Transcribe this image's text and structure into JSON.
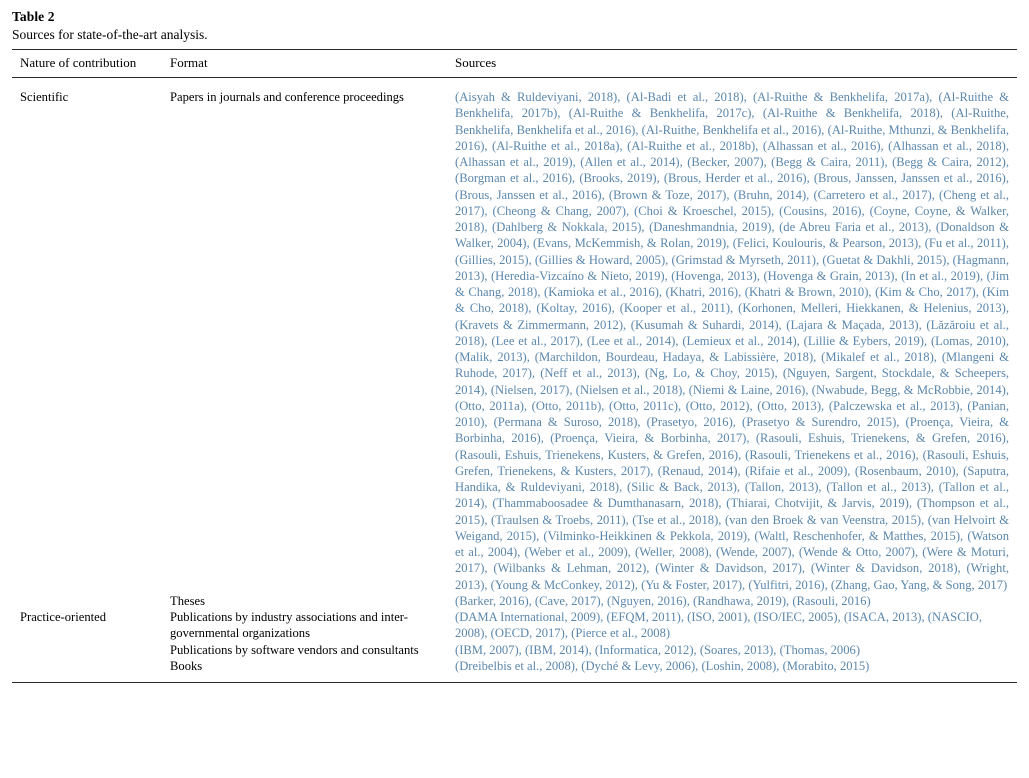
{
  "caption": {
    "label": "Table 2",
    "text": "Sources for state-of-the-art analysis."
  },
  "table": {
    "headers": {
      "nature": "Nature of contribution",
      "format": "Format",
      "sources": "Sources"
    },
    "rows": [
      {
        "nature": "Scientific",
        "format": "Papers in journals and conference proceedings",
        "sources": "(Aisyah & Ruldeviyani, 2018), (Al-Badi et al., 2018), (Al-Ruithe & Benkhelifa, 2017a), (Al-Ruithe & Benkhelifa, 2017b), (Al-Ruithe & Benkhelifa, 2017c), (Al-Ruithe & Benkhelifa, 2018), (Al-Ruithe, Benkhelifa, Benkhelifa et al., 2016), (Al-Ruithe, Benkhelifa et al., 2016), (Al-Ruithe, Mthunzi, & Benkhelifa, 2016), (Al-Ruithe et al., 2018a), (Al-Ruithe et al., 2018b), (Alhassan et al., 2016), (Alhassan et al., 2018), (Alhassan et al., 2019), (Allen et al., 2014), (Becker, 2007), (Begg & Caira, 2011), (Begg & Caira, 2012), (Borgman et al., 2016), (Brooks, 2019), (Brous, Herder et al., 2016), (Brous, Janssen, Janssen et al., 2016), (Brous, Janssen et al., 2016), (Brown & Toze, 2017), (Bruhn, 2014), (Carretero et al., 2017), (Cheng et al., 2017), (Cheong & Chang, 2007), (Choi & Kroeschel, 2015), (Cousins, 2016), (Coyne, Coyne, & Walker, 2018), (Dahlberg & Nokkala, 2015), (Daneshmandnia, 2019), (de Abreu Faria et al., 2013), (Donaldson & Walker, 2004), (Evans, McKemmish, & Rolan, 2019), (Felici, Koulouris, & Pearson, 2013), (Fu et al., 2011), (Gillies, 2015), (Gillies & Howard, 2005), (Grimstad & Myrseth, 2011), (Guetat & Dakhli, 2015), (Hagmann, 2013), (Heredia-Vizcaíno & Nieto, 2019), (Hovenga, 2013), (Hovenga & Grain, 2013), (In et al., 2019), (Jim & Chang, 2018), (Kamioka et al., 2016), (Khatri, 2016), (Khatri & Brown, 2010), (Kim & Cho, 2017), (Kim & Cho, 2018), (Koltay, 2016), (Kooper et al., 2011), (Korhonen, Melleri, Hiekkanen, & Helenius, 2013), (Kravets & Zimmermann, 2012), (Kusumah & Suhardi, 2014), (Lajara & Maçada, 2013), (Lăzăroiu et al., 2018), (Lee et al., 2017), (Lee et al., 2014), (Lemieux et al., 2014), (Lillie & Eybers, 2019), (Lomas, 2010), (Malik, 2013), (Marchildon, Bourdeau, Hadaya, & Labissière, 2018), (Mikalef et al., 2018), (Mlangeni & Ruhode, 2017), (Neff et al., 2013), (Ng, Lo, & Choy, 2015), (Nguyen, Sargent, Stockdale, & Scheepers, 2014), (Nielsen, 2017), (Nielsen et al., 2018), (Niemi & Laine, 2016), (Nwabude, Begg, & McRobbie, 2014), (Otto, 2011a), (Otto, 2011b), (Otto, 2011c), (Otto, 2012), (Otto, 2013), (Palczewska et al., 2013), (Panian, 2010), (Permana & Suroso, 2018), (Prasetyo, 2016), (Prasetyo & Surendro, 2015), (Proença, Vieira, & Borbinha, 2016), (Proença, Vieira, & Borbinha, 2017), (Rasouli, Eshuis, Trienekens, & Grefen, 2016), (Rasouli, Eshuis, Trienekens, Kusters, & Grefen, 2016), (Rasouli, Trienekens et al., 2016), (Rasouli, Eshuis, Grefen, Trienekens, & Kusters, 2017), (Renaud, 2014), (Rifaie et al., 2009), (Rosenbaum, 2010), (Saputra, Handika, & Ruldeviyani, 2018), (Silic & Back, 2013), (Tallon, 2013), (Tallon et al., 2013), (Tallon et al., 2014), (Thammaboosadee & Dumthanasarn, 2018), (Thiarai, Chotvijit, & Jarvis, 2019), (Thompson et al., 2015), (Traulsen & Troebs, 2011), (Tse et al., 2018), (van den Broek & van Veenstra, 2015), (van Helvoirt & Weigand, 2015), (Vilminko-Heikkinen & Pekkola, 2019), (Waltl, Reschenhofer, & Matthes, 2015), (Watson et al., 2004), (Weber et al., 2009), (Weller, 2008), (Wende, 2007), (Wende & Otto, 2007), (Were & Moturi, 2017), (Wilbanks & Lehman, 2012), (Winter & Davidson, 2017), (Winter & Davidson, 2018), (Wright, 2013), (Young & McConkey, 2012), (Yu & Foster, 2017), (Yulfitri, 2016), (Zhang, Gao, Yang, & Song, 2017)"
      },
      {
        "nature": "",
        "format": "Theses",
        "sources": "(Barker, 2016), (Cave, 2017), (Nguyen, 2016), (Randhawa, 2019), (Rasouli, 2016)"
      },
      {
        "nature": "Practice-oriented",
        "format": "Publications by industry associations and inter-governmental organizations",
        "sources": "(DAMA International, 2009), (EFQM, 2011), (ISO, 2001), (ISO/IEC, 2005), (ISACA, 2013), (NASCIO, 2008), (OECD, 2017), (Pierce et al., 2008)"
      },
      {
        "nature": "",
        "format": "Publications by software vendors and consultants",
        "sources": "(IBM, 2007), (IBM, 2014), (Informatica, 2012), (Soares, 2013), (Thomas, 2006)"
      },
      {
        "nature": "",
        "format": "Books",
        "sources": "(Dreibelbis et al., 2008), (Dyché & Levy, 2006), (Loshin, 2008), (Morabito, 2015)"
      }
    ]
  },
  "colors": {
    "link": "#5b87ac",
    "rule": "#2b2b2b",
    "text": "#000000"
  }
}
